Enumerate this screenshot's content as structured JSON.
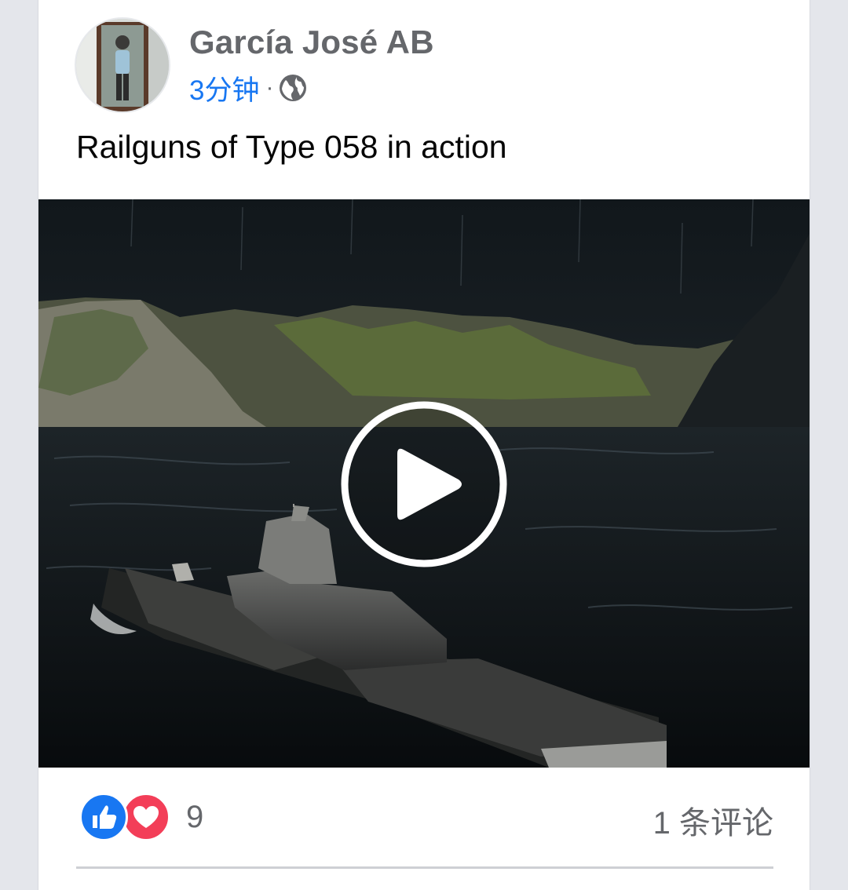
{
  "post": {
    "author": "García José AB",
    "time": "3分钟",
    "separator": "·",
    "privacy_icon": "globe-icon",
    "caption": "Railguns of Type 058 in action"
  },
  "video": {
    "play_icon": "play-icon"
  },
  "footer": {
    "reaction_icons": [
      "like-icon",
      "love-icon"
    ],
    "reaction_count": "9",
    "comment_count": "1 条评论"
  },
  "colors": {
    "link_blue": "#1877f2",
    "like_blue": "#1877f2",
    "love_red": "#f33e58",
    "secondary_text": "#65676b",
    "primary_text": "#050505"
  }
}
